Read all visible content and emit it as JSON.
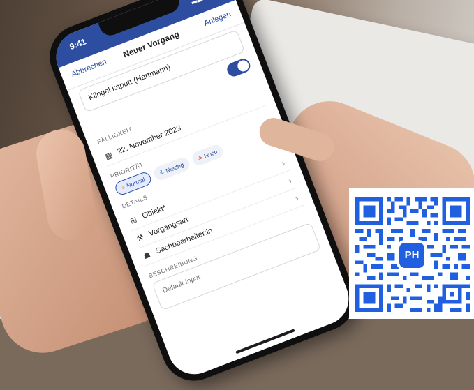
{
  "phone_ui": {
    "status": {
      "time": "9:41",
      "signal": "▂▄▆ ◐"
    },
    "nav": {
      "cancel": "Abbrechen",
      "title": "Neuer Vorgang",
      "add": "Anlegen"
    },
    "title_field": {
      "value": "Klingel kaputt (Hartmann)"
    },
    "due": {
      "label": "FÄLLIGKEIT",
      "date": "22. November 2023"
    },
    "priority": {
      "label": "PRIORITÄT",
      "options": [
        {
          "label": "Normal",
          "selected": true,
          "icon": "≡"
        },
        {
          "label": "Niedrig",
          "selected": false,
          "icon": "≚"
        },
        {
          "label": "Hoch",
          "selected": false,
          "icon": "≙"
        }
      ]
    },
    "details": {
      "label": "DETAILS",
      "items": [
        {
          "label": "Objekt*",
          "icon": "grid-icon"
        },
        {
          "label": "Vorgangsart",
          "icon": "wrench-icon"
        },
        {
          "label": "Sachbearbeiter:in",
          "icon": "person-icon"
        }
      ]
    },
    "description": {
      "label": "BESCHREIBUNG",
      "placeholder": "Default Input"
    }
  },
  "qr": {
    "badge_text": "PH",
    "color": "#1f5fe0"
  },
  "colors": {
    "primary": "#2d4ea0",
    "qr_blue": "#1f5fe0"
  }
}
